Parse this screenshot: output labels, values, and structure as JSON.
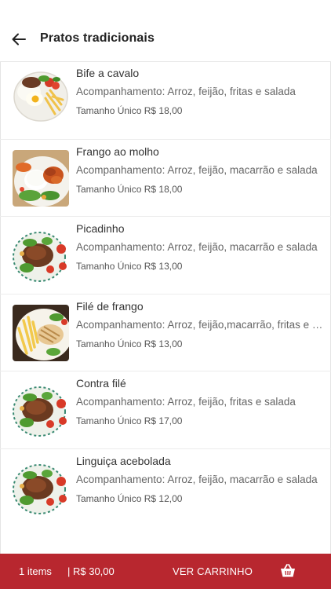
{
  "header": {
    "title": "Pratos tradicionais"
  },
  "items": [
    {
      "name": "Bife a cavalo",
      "description": "Acompanhamento: Arroz, feijão, fritas e salada",
      "size_label": "Tamanho Único",
      "price": "R$ 18,00"
    },
    {
      "name": "Frango ao molho",
      "description": "Acompanhamento: Arroz, feijão, macarrão e salada",
      "size_label": "Tamanho Único",
      "price": "R$ 18,00"
    },
    {
      "name": "Picadinho",
      "description": "Acompanhamento: Arroz, feijão, macarrão e salada",
      "size_label": "Tamanho Único",
      "price": "R$ 13,00"
    },
    {
      "name": "Filé de frango",
      "description": "Acompanhamento: Arroz, feijão,macarrão, fritas e salada",
      "size_label": "Tamanho Único",
      "price": "R$ 13,00"
    },
    {
      "name": "Contra filé",
      "description": "Acompanhamento: Arroz, feijão, fritas e salada",
      "size_label": "Tamanho Único",
      "price": "R$ 17,00"
    },
    {
      "name": "Linguiça acebolada",
      "description": "Acompanhamento: Arroz, feijão, macarrão e salada",
      "size_label": "Tamanho Único",
      "price": "R$ 12,00"
    }
  ],
  "cart": {
    "count_label": "1 items",
    "total_label": "| R$ 30,00",
    "action_label": "VER CARRINHO"
  },
  "colors": {
    "cart_bar": "#b8272f"
  }
}
